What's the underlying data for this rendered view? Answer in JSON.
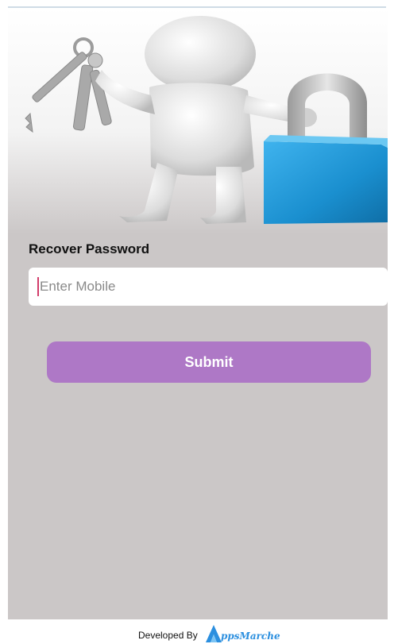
{
  "recover": {
    "title": "Recover Password",
    "mobile_placeholder": "Enter Mobile",
    "mobile_value": "",
    "submit_label": "Submit"
  },
  "footer": {
    "developed_by": "Developed By",
    "brand_name": "ppsMarche"
  },
  "colors": {
    "background": "#cbc7c7",
    "submit_button": "#ae78c6",
    "brand_blue": "#2b8fdf",
    "lock_blue": "#1a8fcf",
    "caret": "#d23c6a"
  },
  "icons": {
    "hero": "person-with-keys-and-padlock-illustration",
    "brand_logo": "appsmarche-logo-icon"
  }
}
